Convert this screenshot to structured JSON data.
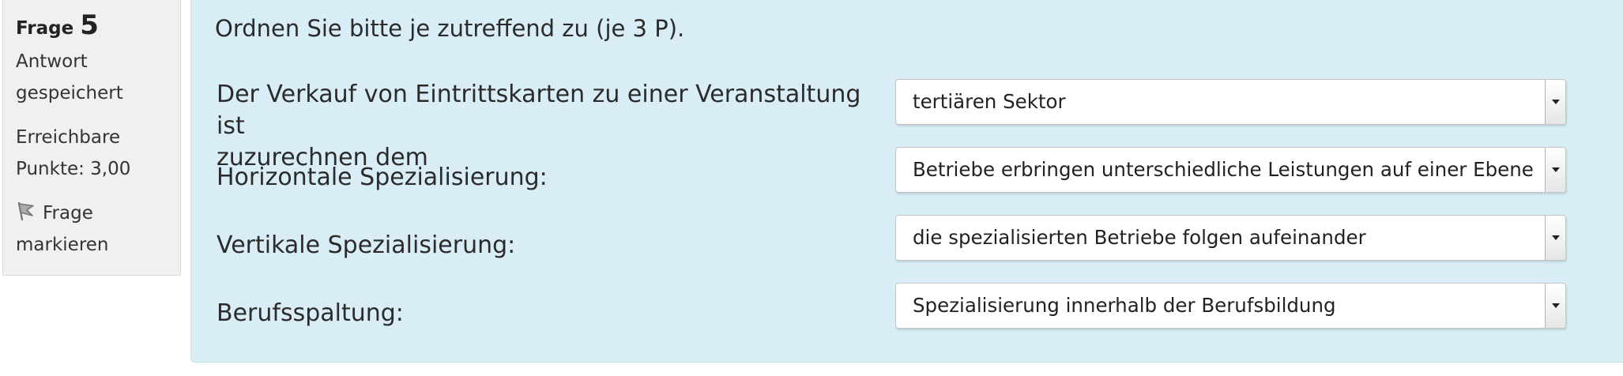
{
  "info": {
    "question_word": "Frage",
    "question_number": "5",
    "status_line1": "Antwort",
    "status_line2": "gespeichert",
    "points_line1": "Erreichbare",
    "points_line2": "Punkte: 3,00",
    "flag_line1": "Frage",
    "flag_line2": "markieren",
    "flag_icon": "flag-icon"
  },
  "question": {
    "text": "Ordnen Sie bitte je zutreffend zu (je 3 P).",
    "rows": [
      {
        "label_line1": "Der Verkauf von Eintrittskarten zu einer Veranstaltung ist",
        "label_line2": "zuzurechnen dem",
        "selected": "tertiären Sektor"
      },
      {
        "label_line1": "Horizontale Spezialisierung:",
        "selected": "Betriebe erbringen unterschiedliche Leistungen auf einer Ebene"
      },
      {
        "label_line1": "Vertikale Spezialisierung:",
        "selected": "die spezialisierten Betriebe folgen aufeinander"
      },
      {
        "label_line1": "Berufsspaltung:",
        "selected": "Spezialisierung innerhalb der Berufsbildung"
      }
    ]
  },
  "colors": {
    "info_panel_bg": "#f0f0f0",
    "content_panel_bg": "#d9edf7",
    "content_panel_border": "#bce8f1"
  }
}
